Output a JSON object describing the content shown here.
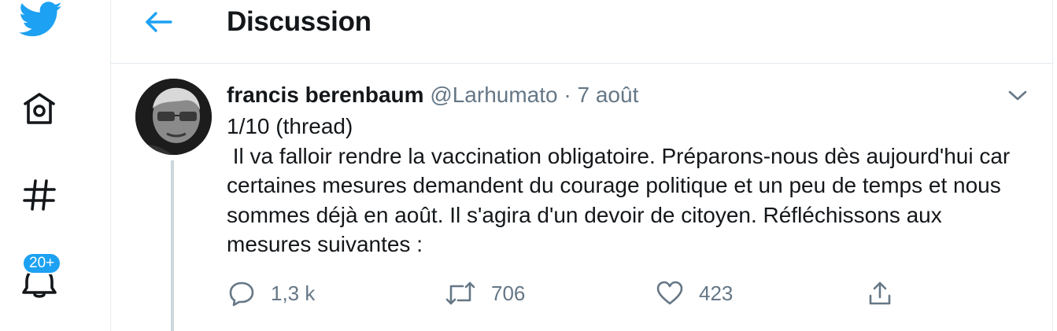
{
  "nav": {
    "items": [
      "twitter-logo",
      "home",
      "explore",
      "notifications"
    ],
    "notification_badge": "20+"
  },
  "header": {
    "back_icon": "arrow-left-icon",
    "title": "Discussion"
  },
  "tweet": {
    "author_name": "francis berenbaum",
    "handle": "@Larhumato",
    "separator": " · ",
    "date": "7 août",
    "text": "1/10 (thread)\n Il va falloir rendre la vaccination obligatoire. Préparons-nous dès aujourd'hui car certaines mesures demandent du courage politique et un peu de temps et nous sommes déjà en août. Il s'agira d'un devoir de citoyen. Réfléchissons aux mesures suivantes :",
    "actions": {
      "reply_count": "1,3 k",
      "retweet_count": "706",
      "like_count": "423"
    }
  },
  "colors": {
    "accent": "#1da1f2",
    "text": "#14171a",
    "secondary": "#657786",
    "border": "#e6ecf0"
  }
}
